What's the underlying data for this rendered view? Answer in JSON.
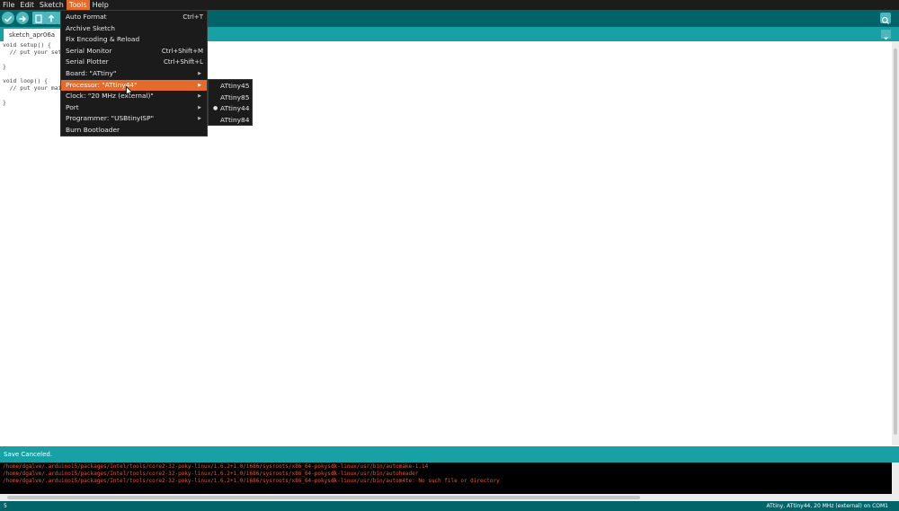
{
  "menubar": {
    "items": [
      "File",
      "Edit",
      "Sketch",
      "Tools",
      "Help"
    ],
    "active_index": 3
  },
  "toolbar": {
    "buttons": [
      "verify",
      "upload",
      "new",
      "open",
      "save"
    ],
    "right_icon": "serial-monitor-icon"
  },
  "tab": {
    "label": "sketch_apr06a"
  },
  "editor": {
    "lines": [
      "void setup() {",
      "  // put your set",
      "",
      "}",
      "",
      "void loop() {",
      "  // put your mai",
      "",
      "}"
    ]
  },
  "tools_menu": {
    "items": [
      {
        "label": "Auto Format",
        "shortcut": "Ctrl+T",
        "submenu": false
      },
      {
        "label": "Archive Sketch",
        "shortcut": "",
        "submenu": false
      },
      {
        "label": "Fix Encoding & Reload",
        "shortcut": "",
        "submenu": false
      },
      {
        "label": "Serial Monitor",
        "shortcut": "Ctrl+Shift+M",
        "submenu": false
      },
      {
        "label": "Serial Plotter",
        "shortcut": "Ctrl+Shift+L",
        "submenu": false
      },
      {
        "label": "Board: \"ATtiny\"",
        "shortcut": "",
        "submenu": true
      },
      {
        "label": "Processor: \"ATtiny44\"",
        "shortcut": "",
        "submenu": true,
        "highlighted": true
      },
      {
        "label": "Clock: \"20 MHz (external)\"",
        "shortcut": "",
        "submenu": true
      },
      {
        "label": "Port",
        "shortcut": "",
        "submenu": true
      },
      {
        "label": "Programmer: \"USBtinyISP\"",
        "shortcut": "",
        "submenu": true
      },
      {
        "label": "Burn Bootloader",
        "shortcut": "",
        "submenu": false
      }
    ]
  },
  "processor_submenu": {
    "items": [
      {
        "label": "ATtiny45",
        "selected": false
      },
      {
        "label": "ATtiny85",
        "selected": false
      },
      {
        "label": "ATtiny44",
        "selected": true
      },
      {
        "label": "ATtiny84",
        "selected": false
      }
    ]
  },
  "status": {
    "message": "Save Canceled."
  },
  "console": {
    "lines": [
      "/home/dgalve/.arduino15/packages/Intel/tools/core2-32-poky-linux/1.6.2+1.0/i686/sysroots/x86_64-pokysdk-linux/usr/bin/automake-1.14",
      "/home/dgalve/.arduino15/packages/Intel/tools/core2-32-poky-linux/1.6.2+1.0/i686/sysroots/x86_64-pokysdk-linux/usr/bin/autoheader",
      "/home/dgalve/.arduino15/packages/Intel/tools/core2-32-poky-linux/1.6.2+1.0/i686/sysroots/x86_64-pokysdk-linux/usr/bin/autom4te: No such file or directory"
    ]
  },
  "footer": {
    "line_number": "5",
    "board_info": "ATtiny, ATtiny44, 20 MHz (external) on COM1"
  },
  "colors": {
    "toolbar": "#006468",
    "tabstrip": "#17a1a5",
    "menu_highlight": "#e36b2b",
    "console_text": "#e3572a",
    "button": "#4db7bb"
  }
}
